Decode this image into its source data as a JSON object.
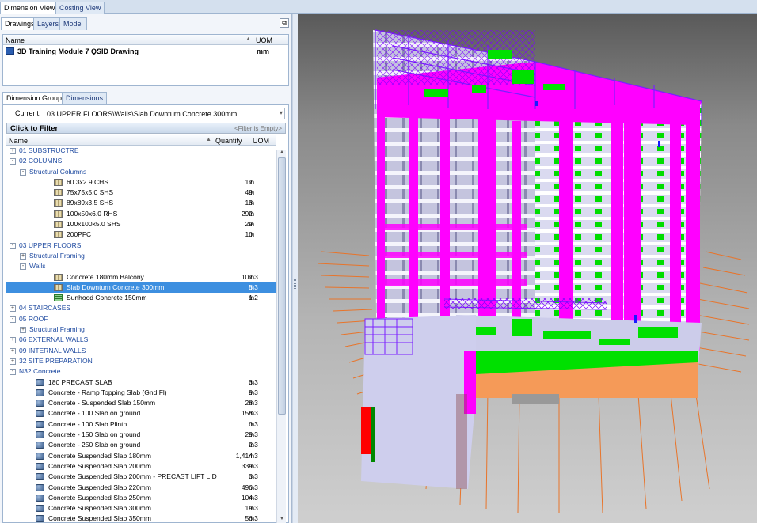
{
  "top_tabs": [
    "Dimension View",
    "Costing View"
  ],
  "drawings_tabs": [
    "Drawings",
    "Layers",
    "Model"
  ],
  "drawings_table": {
    "headers": {
      "name": "Name",
      "uom": "UOM"
    },
    "row": {
      "name": "3D Training Module 7 QSID Drawing",
      "uom": "mm"
    }
  },
  "groups_tabs": [
    "Dimension Groups",
    "Dimensions"
  ],
  "current": {
    "label": "Current:",
    "value": "03 UPPER FLOORS\\Walls\\Slab Downturn Concrete 300mm"
  },
  "filter": {
    "label": "Click to Filter",
    "empty": "<Filter is Empty>"
  },
  "tree_headers": {
    "name": "Name",
    "quantity": "Quantity",
    "uom": "UOM"
  },
  "tree": [
    {
      "level": 0,
      "exp": "+",
      "label": "01 SUBSTRUCTRE",
      "type": "group"
    },
    {
      "level": 0,
      "exp": "-",
      "label": "02 COLUMNS",
      "type": "group"
    },
    {
      "level": 1,
      "exp": "-",
      "label": "Structural Columns",
      "type": "group"
    },
    {
      "level": 2,
      "icon": "bar",
      "label": "60.3x2.9 CHS",
      "qty": "17",
      "uom": "m"
    },
    {
      "level": 2,
      "icon": "bar",
      "label": "75x75x5.0 SHS",
      "qty": "49",
      "uom": "m"
    },
    {
      "level": 2,
      "icon": "bar",
      "label": "89x89x3.5 SHS",
      "qty": "13",
      "uom": "m"
    },
    {
      "level": 2,
      "icon": "bar",
      "label": "100x50x6.0 RHS",
      "qty": "292",
      "uom": "m"
    },
    {
      "level": 2,
      "icon": "bar",
      "label": "100x100x5.0 SHS",
      "qty": "29",
      "uom": "m"
    },
    {
      "level": 2,
      "icon": "bar",
      "label": "200PFC",
      "qty": "10",
      "uom": "m"
    },
    {
      "level": 0,
      "exp": "-",
      "label": "03 UPPER FLOORS",
      "type": "group"
    },
    {
      "level": 1,
      "exp": "+",
      "label": "Structural Framing",
      "type": "group"
    },
    {
      "level": 1,
      "exp": "-",
      "label": "Walls",
      "type": "group"
    },
    {
      "level": 2,
      "icon": "bar",
      "label": "Concrete 180mm Balcony",
      "qty": "107",
      "uom": "m3"
    },
    {
      "level": 2,
      "icon": "bar",
      "label": "Slab Downturn Concrete 300mm",
      "qty": "5",
      "uom": "m3",
      "selected": true
    },
    {
      "level": 2,
      "icon": "grid",
      "label": "Sunhood Concrete 150mm",
      "qty": "1",
      "uom": "m2"
    },
    {
      "level": 0,
      "exp": "+",
      "label": "04 STAIRCASES",
      "type": "group"
    },
    {
      "level": 0,
      "exp": "-",
      "label": "05 ROOF",
      "type": "group"
    },
    {
      "level": 1,
      "exp": "+",
      "label": "Structural Framing",
      "type": "group"
    },
    {
      "level": 0,
      "exp": "+",
      "label": "06 EXTERNAL WALLS",
      "type": "group"
    },
    {
      "level": 0,
      "exp": "+",
      "label": "09 INTERNAL WALLS",
      "type": "group"
    },
    {
      "level": 0,
      "exp": "+",
      "label": "32 SITE PREPARATION",
      "type": "group"
    },
    {
      "level": 0,
      "exp": "-",
      "label": "N32 Concrete",
      "type": "group"
    },
    {
      "level": 1,
      "icon": "cube",
      "label": "180 PRECAST SLAB",
      "qty": "3",
      "uom": "m3"
    },
    {
      "level": 1,
      "icon": "cube",
      "label": "Concrete -  Ramp Topping Slab (Gnd Fl)",
      "qty": "9",
      "uom": "m3"
    },
    {
      "level": 1,
      "icon": "cube",
      "label": "Concrete -  Suspended Slab 150mm",
      "qty": "28",
      "uom": "m3"
    },
    {
      "level": 1,
      "icon": "cube",
      "label": "Concrete - 100 Slab on ground",
      "qty": "158",
      "uom": "m3"
    },
    {
      "level": 1,
      "icon": "cube",
      "label": "Concrete - 100 Slab Plinth",
      "qty": "0",
      "uom": "m3"
    },
    {
      "level": 1,
      "icon": "cube",
      "label": "Concrete - 150 Slab on ground",
      "qty": "29",
      "uom": "m3"
    },
    {
      "level": 1,
      "icon": "cube",
      "label": "Concrete - 250 Slab on ground",
      "qty": "2",
      "uom": "m3"
    },
    {
      "level": 1,
      "icon": "cube",
      "label": "Concrete Suspended Slab 180mm",
      "qty": "1,414",
      "uom": "m3"
    },
    {
      "level": 1,
      "icon": "cube",
      "label": "Concrete Suspended Slab 200mm",
      "qty": "339",
      "uom": "m3"
    },
    {
      "level": 1,
      "icon": "cube",
      "label": "Concrete Suspended Slab 200mm - PRECAST LIFT LID",
      "qty": "3",
      "uom": "m3"
    },
    {
      "level": 1,
      "icon": "cube",
      "label": "Concrete Suspended Slab 220mm",
      "qty": "496",
      "uom": "m3"
    },
    {
      "level": 1,
      "icon": "cube",
      "label": "Concrete Suspended Slab 250mm",
      "qty": "104",
      "uom": "m3"
    },
    {
      "level": 1,
      "icon": "cube",
      "label": "Concrete Suspended Slab 300mm",
      "qty": "19",
      "uom": "m3"
    },
    {
      "level": 1,
      "icon": "cube",
      "label": "Concrete Suspended Slab 350mm",
      "qty": "56",
      "uom": "m3"
    }
  ],
  "colors": {
    "selection": "#3d8fe0",
    "group_text": "#1e4aa0",
    "model_magenta": "#ff00ff",
    "model_green": "#00e000"
  }
}
